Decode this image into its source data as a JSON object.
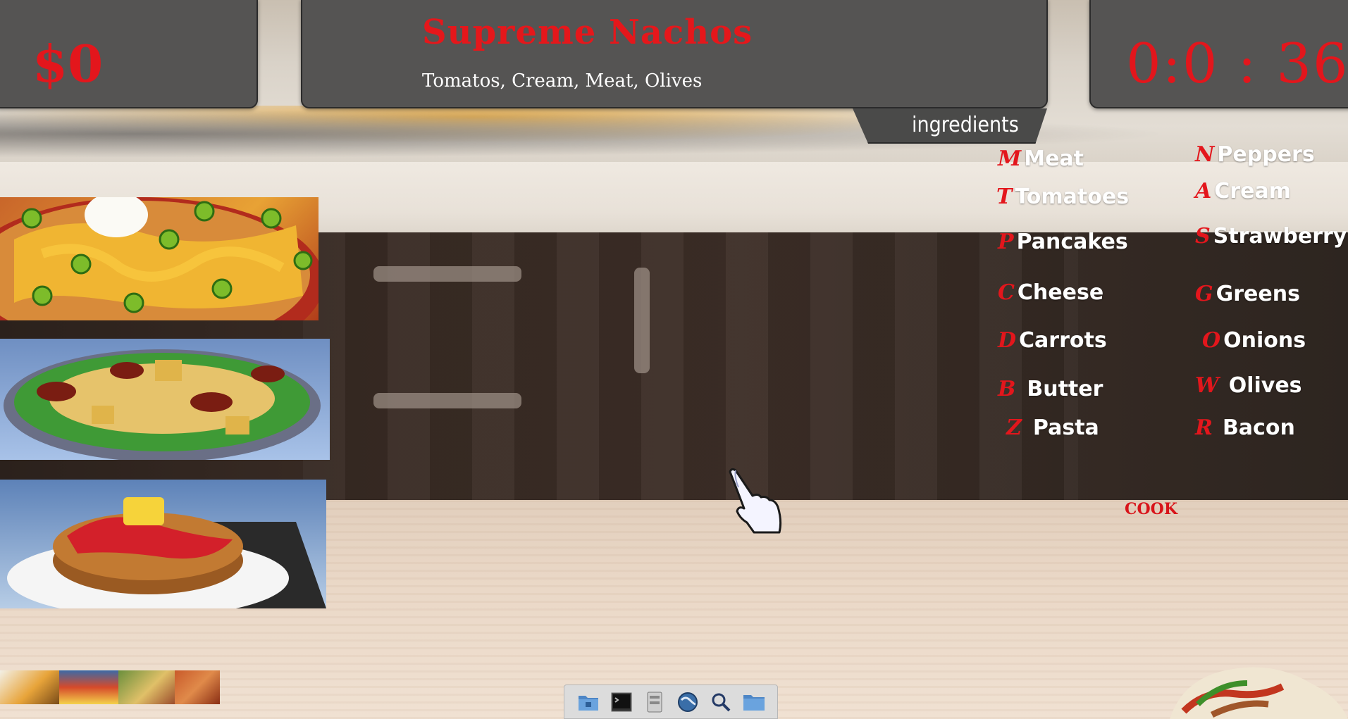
{
  "hud": {
    "money": "$0",
    "timer": "0:0 : 36"
  },
  "order": {
    "title": "Supreme Nachos",
    "ingredients": "Tomatos, Cream, Meat, Olives"
  },
  "ingredients_tab": "ingredients",
  "ingredients": [
    {
      "key": "M",
      "name": "Meat"
    },
    {
      "key": "N",
      "name": "Peppers"
    },
    {
      "key": "T",
      "name": "Tomatoes"
    },
    {
      "key": "A",
      "name": "Cream"
    },
    {
      "key": "P",
      "name": "Pancakes"
    },
    {
      "key": "S",
      "name": "Strawberry"
    },
    {
      "key": "C",
      "name": "Cheese"
    },
    {
      "key": "G",
      "name": "Greens"
    },
    {
      "key": "D",
      "name": "Carrots"
    },
    {
      "key": "O",
      "name": "Onions"
    },
    {
      "key": "B",
      "name": "Butter"
    },
    {
      "key": "W",
      "name": "Olives"
    },
    {
      "key": "Z",
      "name": "Pasta"
    },
    {
      "key": "R",
      "name": "Bacon"
    }
  ],
  "cook_label": "cook",
  "colors": {
    "accent_red": "#e3161c",
    "panel": "#555453"
  },
  "dock_icons": [
    "home-folder-icon",
    "terminal-icon",
    "file-manager-icon",
    "web-browser-icon",
    "search-icon",
    "folder-icon"
  ]
}
